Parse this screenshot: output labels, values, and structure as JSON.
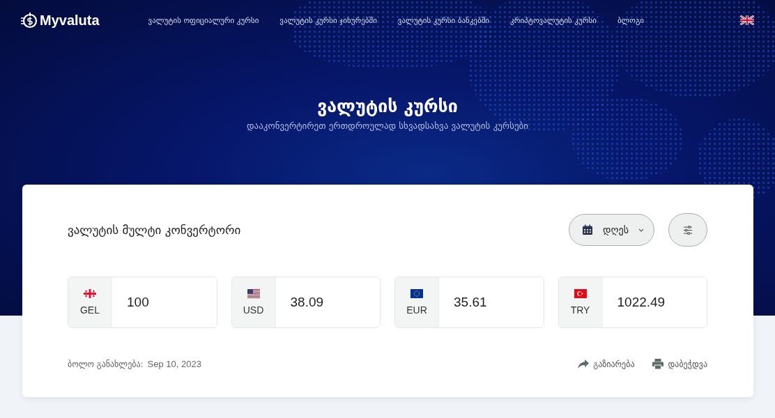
{
  "header": {
    "logo": "Myvaluta",
    "nav": [
      {
        "label": "ვალუტის ოფიციალური კურსი"
      },
      {
        "label": "ვალუტის კურსი ჯიხურებში"
      },
      {
        "label": "ვალუტის კურსი ბანკებში"
      },
      {
        "label": "კრიპტოვალუტის კურსი"
      },
      {
        "label": "ბლოგი"
      }
    ]
  },
  "hero": {
    "title": "ვალუტის კურსი",
    "subtitle": "დააკონვერტირეთ ერთდროულად სხვადსახვა ვალუტის კურსები"
  },
  "converter": {
    "title": "ვალუტის მულტი კონვერტორი",
    "date_select": {
      "value": "დღეს"
    },
    "currencies": [
      {
        "kind": "georgia",
        "code": "GEL",
        "value": "100"
      },
      {
        "kind": "usa",
        "code": "USD",
        "value": "38.09"
      },
      {
        "kind": "eu",
        "code": "EUR",
        "value": "35.61"
      },
      {
        "kind": "turkey",
        "code": "TRY",
        "value": "1022.49"
      }
    ],
    "updated_label": "ბოლო განახლება:",
    "updated_date": "Sep 10, 2023",
    "share": "გაზიარება",
    "print": "დაბეჭდვა"
  }
}
